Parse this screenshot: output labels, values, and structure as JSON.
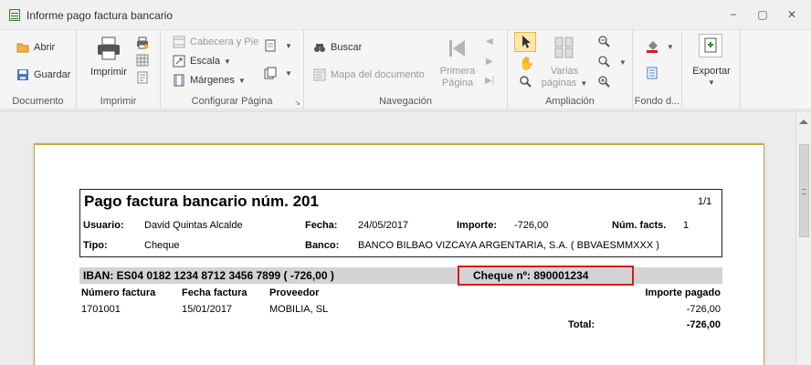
{
  "window": {
    "title": "Informe  pago factura bancario",
    "controls": {
      "minimize": "−",
      "restore": "▢",
      "close": "✕"
    }
  },
  "ribbon": {
    "groups": {
      "documento": "Documento",
      "imprimir": "Imprimir",
      "configurar": "Configurar Página",
      "navegacion": "Navegación",
      "ampliacion": "Ampliación",
      "fondo": "Fondo d...",
      "exportar_group": ""
    },
    "buttons": {
      "abrir": "Abrir",
      "guardar": "Guardar",
      "imprimir": "Imprimir",
      "cabecera_pie": "Cabecera y Pie",
      "escala": "Escala",
      "margenes": "Márgenes",
      "buscar": "Buscar",
      "mapa": "Mapa del documento",
      "primera_pagina_1": "Primera",
      "primera_pagina_2": "Página",
      "varias_1": "Varias",
      "varias_2": "páginas",
      "exportar": "Exportar"
    }
  },
  "report": {
    "title": "Pago factura bancario núm. 201",
    "page_counter": "1/1",
    "fields": {
      "usuario_label": "Usuario:",
      "usuario_value": "David Quintas Alcalde",
      "fecha_label": "Fecha:",
      "fecha_value": "24/05/2017",
      "importe_label": "Importe:",
      "importe_value": "-726,00",
      "num_facts_label": "Núm. facts.",
      "num_facts_value": "1",
      "tipo_label": "Tipo:",
      "tipo_value": "Cheque",
      "banco_label": "Banco:",
      "banco_value": "BANCO BILBAO VIZCAYA ARGENTARIA, S.A. ( BBVAESMMXXX )"
    },
    "iban_line": "IBAN: ES04 0182 1234 8712 3456 7899 ( -726,00 )",
    "cheque_line": "Cheque nº: 890001234",
    "table": {
      "headers": [
        "Número factura",
        "Fecha factura",
        "Proveedor",
        "Importe pagado"
      ],
      "rows": [
        [
          "1701001",
          "15/01/2017",
          "MOBILIA, SL",
          "-726,00"
        ]
      ],
      "total_label": "Total:",
      "total_value": "-726,00"
    }
  },
  "colors": {
    "highlight_border": "#d21c1c",
    "page_border": "#c9a948",
    "band": "#d3d3d3"
  }
}
